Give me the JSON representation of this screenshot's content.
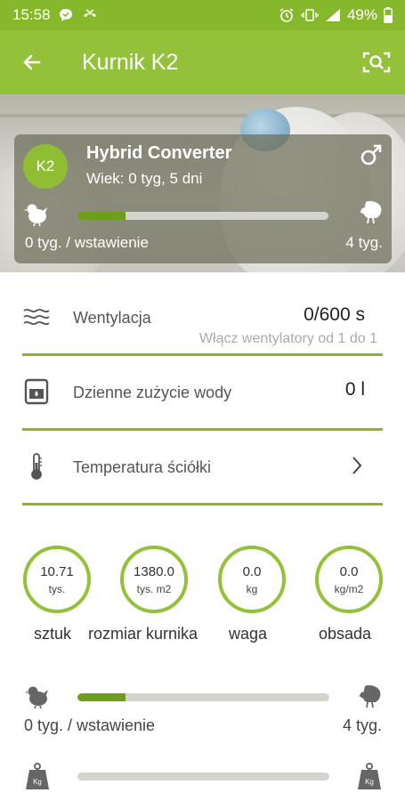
{
  "status_bar": {
    "time": "15:58",
    "battery": "49%"
  },
  "app_bar": {
    "title": "Kurnik K2",
    "back_icon": "arrow-back-icon",
    "action_icon": "scan-search-icon"
  },
  "flock_card": {
    "badge": "K2",
    "breed": "Hybrid Converter",
    "age": "Wiek: 0 tyg, 5 dni",
    "gender_icon": "male-symbol-icon",
    "progress_fraction": 0.19,
    "progress_start_label": "0 tyg. / wstawienie",
    "progress_end_label": "4 tyg."
  },
  "rows": [
    {
      "label": "Wentylacja",
      "value": "0/600 s",
      "hint": "Włącz wentylatory od 1 do 1",
      "icon": "air-waves-icon"
    },
    {
      "label": "Dzienne zużycie wody",
      "value": "0 l",
      "icon": "water-glass-icon"
    },
    {
      "label": "Temperatura ściółki",
      "icon": "thermometer-icon",
      "action_icon": "chevron-right-icon"
    }
  ],
  "stats": [
    {
      "value": "10.71",
      "unit": "tys.",
      "label": "sztuk"
    },
    {
      "value": "1380.0",
      "unit": "tys. m2",
      "label": "rozmiar kurnika"
    },
    {
      "value": "0.0",
      "unit": "kg",
      "label": "waga"
    },
    {
      "value": "0.0",
      "unit": "kg/m2",
      "label": "obsada"
    }
  ],
  "age_progress": {
    "fraction": 0.19,
    "start_label": "0 tyg. / wstawienie",
    "end_label": "4 tyg."
  },
  "weight_progress": {
    "fraction": 0.0,
    "start_icon_text": "Kg",
    "end_icon_text": "Kg"
  },
  "colors": {
    "brand_green": "#93c23a",
    "status_green": "#86b82c",
    "progress_fill": "#6c9d1b"
  }
}
